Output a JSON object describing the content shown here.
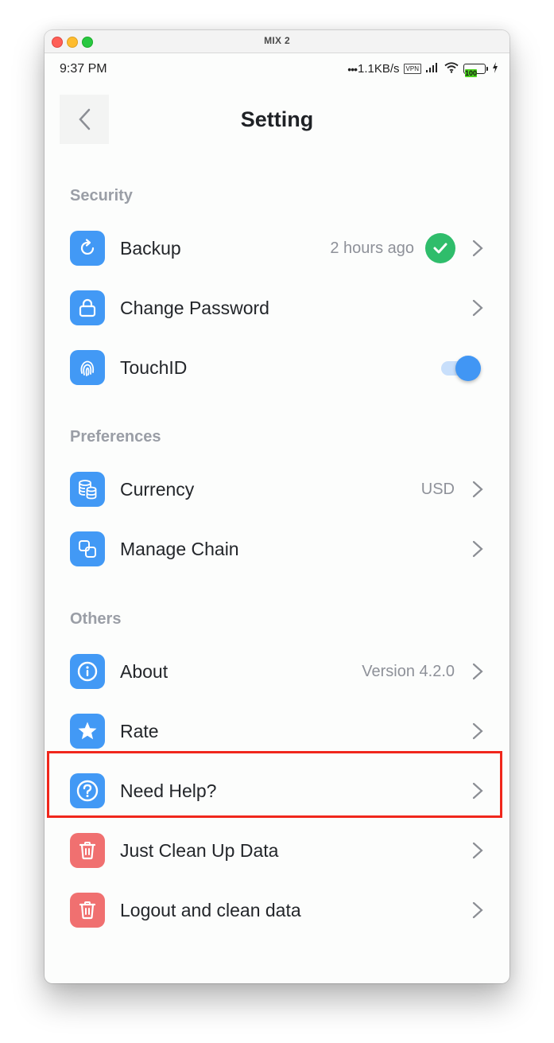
{
  "window": {
    "title": "MIX 2",
    "controls": [
      "close",
      "minimize",
      "maximize"
    ]
  },
  "status_bar": {
    "time": "9:37 PM",
    "network_speed": "1.1KB/s",
    "vpn": "VPN",
    "battery": "100",
    "icons": [
      "dots-icon",
      "vpn-icon",
      "signal-icon",
      "wifi-icon",
      "battery-icon",
      "charging-icon"
    ]
  },
  "header": {
    "title": "Setting",
    "back_icon": "chevron-left-icon"
  },
  "sections": [
    {
      "title": "Security",
      "items": [
        {
          "label": "Backup",
          "icon": "refresh-icon",
          "value": "2 hours ago",
          "status": "check-icon"
        },
        {
          "label": "Change Password",
          "icon": "lock-icon"
        },
        {
          "label": "TouchID",
          "icon": "fingerprint-icon",
          "toggle": true
        }
      ]
    },
    {
      "title": "Preferences",
      "items": [
        {
          "label": "Currency",
          "icon": "coins-icon",
          "value": "USD"
        },
        {
          "label": "Manage Chain",
          "icon": "link-squares-icon"
        }
      ]
    },
    {
      "title": "Others",
      "items": [
        {
          "label": "About",
          "icon": "info-icon",
          "value": "Version 4.2.0"
        },
        {
          "label": "Rate",
          "icon": "star-icon"
        },
        {
          "label": "Need Help?",
          "icon": "question-icon",
          "highlighted": true
        },
        {
          "label": "Just Clean Up Data",
          "icon": "trash-icon",
          "danger": true
        },
        {
          "label": "Logout and clean data",
          "icon": "trash-icon",
          "danger": true
        }
      ]
    }
  ],
  "colors": {
    "accent": "#4299f5",
    "danger": "#f07070",
    "success": "#2fbd6b",
    "highlight_border": "#f0271c",
    "section_title": "#9a9ea6"
  }
}
